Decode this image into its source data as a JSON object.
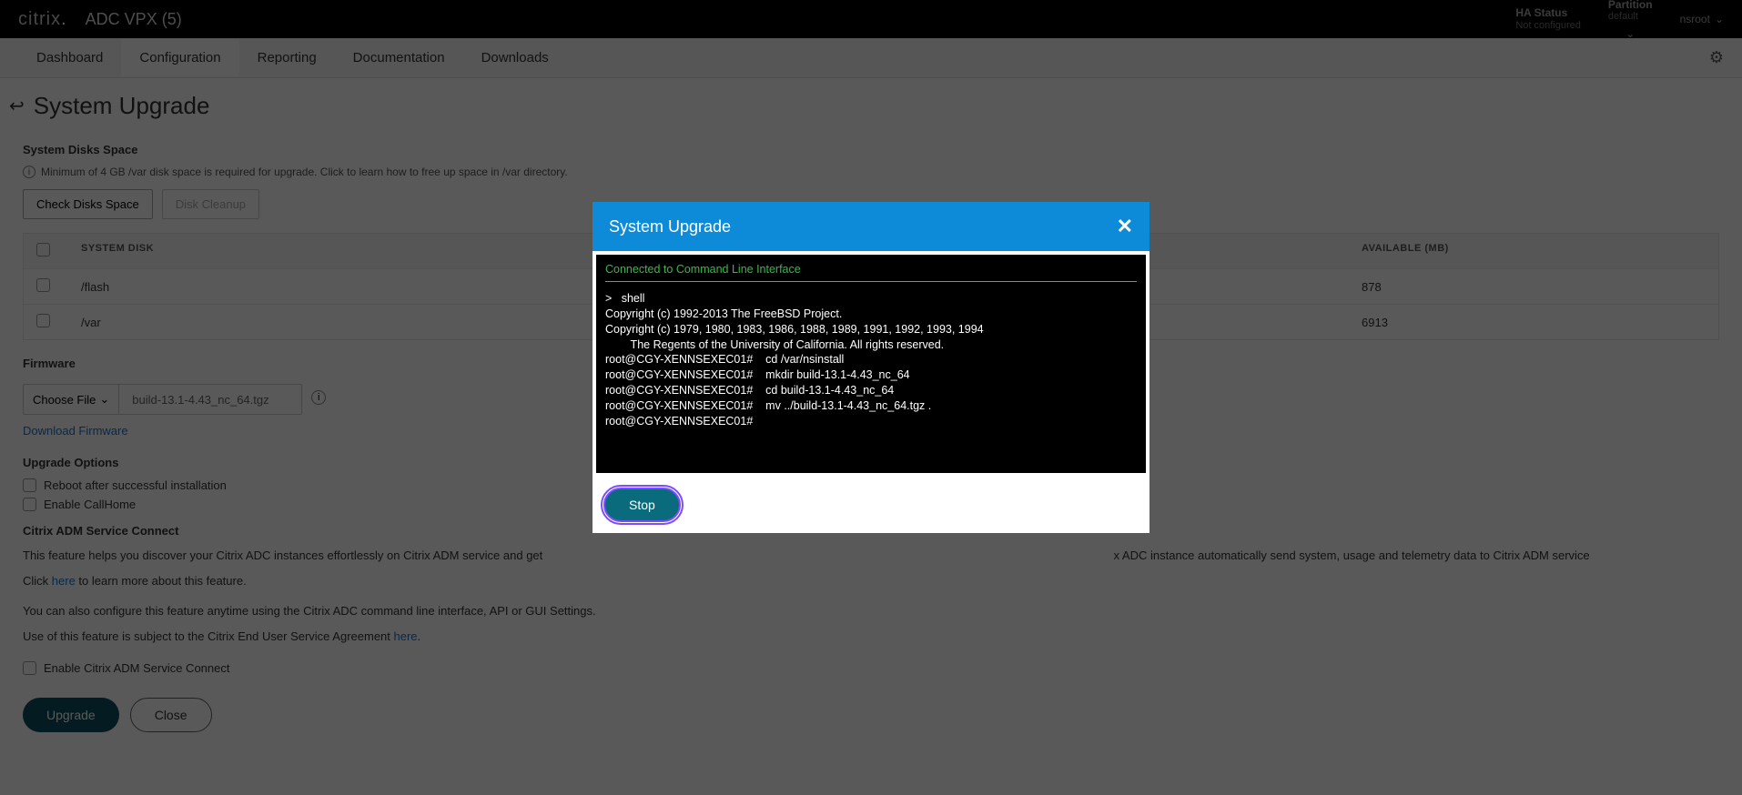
{
  "topbar": {
    "brand": "citrix",
    "product": "ADC VPX (5)",
    "ha_label": "HA Status",
    "ha_value": "Not configured",
    "partition_label": "Partition",
    "partition_value": "default",
    "user": "nsroot"
  },
  "nav": {
    "items": [
      "Dashboard",
      "Configuration",
      "Reporting",
      "Documentation",
      "Downloads"
    ],
    "active": 1
  },
  "page": {
    "title": "System Upgrade"
  },
  "disks": {
    "section_label": "System Disks Space",
    "info_text": "Minimum of 4 GB /var disk space is required for upgrade. Click to learn how to free up space in /var directory.",
    "check_btn": "Check Disks Space",
    "cleanup_btn": "Disk Cleanup",
    "header_disk": "SYSTEM DISK",
    "header_avail": "AVAILABLE (MB)",
    "rows": [
      {
        "name": "/flash",
        "avail": "878"
      },
      {
        "name": "/var",
        "avail": "6913"
      }
    ]
  },
  "firmware": {
    "section_label": "Firmware",
    "choose_label": "Choose File",
    "filename": "build-13.1-4.43_nc_64.tgz",
    "download_link": "Download Firmware"
  },
  "options": {
    "section_label": "Upgrade Options",
    "reboot_label": "Reboot after successful installation",
    "callhome_label": "Enable CallHome"
  },
  "adm": {
    "section_label": "Citrix ADM Service Connect",
    "desc1_a": "This feature helps you discover your Citrix ADC instances effortlessly on Citrix ADM service and get",
    "desc1_b": "x ADC instance automatically send system, usage and telemetry data to Citrix ADM service",
    "desc2_a": "Click ",
    "desc2_link": "here",
    "desc2_b": " to learn more about this feature.",
    "desc3": "You can also configure this feature anytime using the Citrix ADC command line interface, API or GUI Settings.",
    "desc4_a": "Use of this feature is subject to the Citrix End User Service Agreement ",
    "desc4_link": "here",
    "enable_label": "Enable Citrix ADM Service Connect"
  },
  "footer": {
    "upgrade": "Upgrade",
    "close": "Close"
  },
  "modal": {
    "title": "System Upgrade",
    "status": "Connected to Command Line Interface",
    "lines": [
      ">   shell",
      "Copyright (c) 1992-2013 The FreeBSD Project.",
      "Copyright (c) 1979, 1980, 1983, 1986, 1988, 1989, 1991, 1992, 1993, 1994",
      "        The Regents of the University of California. All rights reserved.",
      "",
      "root@CGY-XENNSEXEC01#    cd /var/nsinstall",
      "root@CGY-XENNSEXEC01#    mkdir build-13.1-4.43_nc_64",
      "root@CGY-XENNSEXEC01#    cd build-13.1-4.43_nc_64",
      "root@CGY-XENNSEXEC01#    mv ../build-13.1-4.43_nc_64.tgz .",
      "root@CGY-XENNSEXEC01#"
    ],
    "stop_btn": "Stop"
  }
}
